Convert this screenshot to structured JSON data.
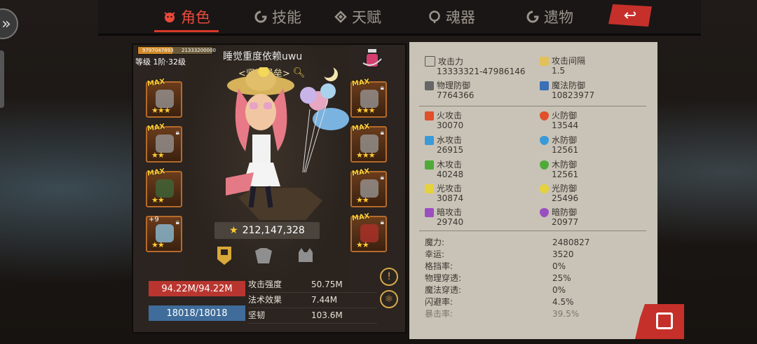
{
  "tabs": [
    {
      "label": "角色",
      "icon": "demon-face-icon",
      "active": true
    },
    {
      "label": "技能",
      "icon": "skill-swirl-icon",
      "active": false
    },
    {
      "label": "天赋",
      "icon": "talent-wings-icon",
      "active": false
    },
    {
      "label": "魂器",
      "icon": "soul-drop-icon",
      "active": false
    },
    {
      "label": "遗物",
      "icon": "relic-swirl-icon",
      "active": false
    }
  ],
  "colors": {
    "accent": "#d7392b",
    "hp": "#b8362f",
    "mp": "#3f6c9a",
    "panel": "#c9c3b7"
  },
  "character": {
    "exp_text": "9797047893",
    "exp_max": "21333200000",
    "exp_fraction": 0.46,
    "level": "等级 1阶·32级",
    "name": "睡觉重度依赖uwu",
    "title": "<坚固堡垒>",
    "power": "212,147,328",
    "hp": "94.22M/94.22M",
    "mp": "18018/18018"
  },
  "equipment": {
    "left": [
      {
        "name": "weapon-slot",
        "max": "MAX",
        "stars": "★★★"
      },
      {
        "name": "gloves-slot",
        "max": "MAX",
        "stars": "★★"
      },
      {
        "name": "staff-slot",
        "max": "MAX",
        "stars": "★★"
      },
      {
        "name": "crystal-slot",
        "plus": "+9",
        "stars": "★★"
      }
    ],
    "right": [
      {
        "name": "helmet-slot",
        "max": "MAX",
        "stars": "★★★"
      },
      {
        "name": "armor-slot",
        "max": "MAX",
        "stars": "★★★"
      },
      {
        "name": "boots-slot",
        "max": "MAX",
        "stars": "★★"
      },
      {
        "name": "amulet-slot",
        "max": "MAX",
        "stars": "★★"
      }
    ]
  },
  "sub_stats": [
    {
      "label": "攻击强度",
      "value": "50.75M"
    },
    {
      "label": "法术效果",
      "value": "7.44M"
    },
    {
      "label": "坚韧",
      "value": "103.6M"
    }
  ],
  "stats": {
    "attack": {
      "label": "攻击力",
      "value": "13333321-47986146"
    },
    "attack_interval": {
      "label": "攻击间隔",
      "value": "1.5"
    },
    "phys_def": {
      "label": "物理防御",
      "value": "7764366"
    },
    "magic_def": {
      "label": "魔法防御",
      "value": "10823977"
    },
    "fire_atk": {
      "label": "火攻击",
      "value": "30070"
    },
    "fire_def": {
      "label": "火防御",
      "value": "13544"
    },
    "water_atk": {
      "label": "水攻击",
      "value": "26915"
    },
    "water_def": {
      "label": "水防御",
      "value": "12561"
    },
    "wood_atk": {
      "label": "木攻击",
      "value": "40248"
    },
    "wood_def": {
      "label": "木防御",
      "value": "12561"
    },
    "light_atk": {
      "label": "光攻击",
      "value": "30874"
    },
    "light_def": {
      "label": "光防御",
      "value": "25496"
    },
    "dark_atk": {
      "label": "暗攻击",
      "value": "29740"
    },
    "dark_def": {
      "label": "暗防御",
      "value": "20977"
    }
  },
  "misc_stats": [
    {
      "label": "魔力:",
      "value": "2480827"
    },
    {
      "label": "幸运:",
      "value": "3520"
    },
    {
      "label": "格挡率:",
      "value": "0%"
    },
    {
      "label": "物理穿透:",
      "value": "25%"
    },
    {
      "label": "魔法穿透:",
      "value": "0%"
    },
    {
      "label": "闪避率:",
      "value": "4.5%"
    },
    {
      "label": "暴击率:",
      "value": "39.5%"
    }
  ]
}
